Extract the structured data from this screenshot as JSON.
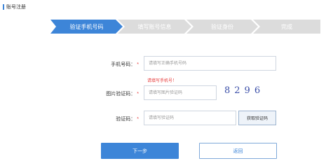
{
  "header": {
    "title": "账号注册"
  },
  "steps": [
    {
      "label": "验证手机号码",
      "active": true
    },
    {
      "label": "填写账号信息",
      "active": false
    },
    {
      "label": "验证身份",
      "active": false
    },
    {
      "label": "完成",
      "active": false
    }
  ],
  "colors": {
    "accent": "#3d85d8",
    "step_inactive": "#dcdcdc",
    "error": "#e63b3b"
  },
  "form": {
    "phone": {
      "label": "手机号码：",
      "required": "*",
      "placeholder": "请填写正确手机号码",
      "error": "请填写手机号！"
    },
    "image_captcha": {
      "label": "图片验证码：",
      "required": "*",
      "placeholder": "请填写图片验证码",
      "captcha_text": "8296"
    },
    "sms_code": {
      "label": "验证码：",
      "required": "*",
      "placeholder": "请填写验证码",
      "button": "获取验证码"
    }
  },
  "actions": {
    "next": "下一步",
    "back": "返回"
  }
}
